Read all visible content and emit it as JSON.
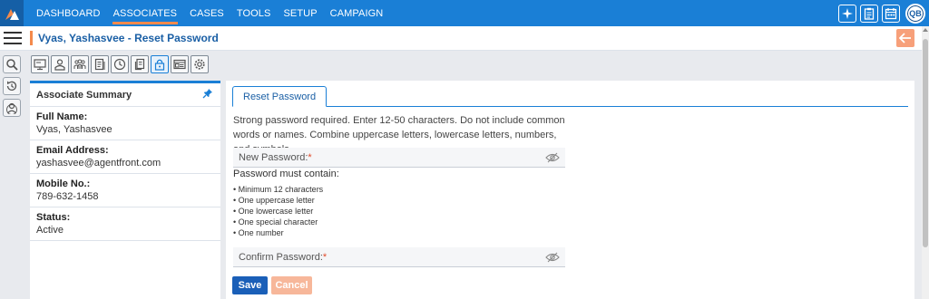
{
  "nav": {
    "items": [
      {
        "label": "DASHBOARD"
      },
      {
        "label": "ASSOCIATES"
      },
      {
        "label": "CASES"
      },
      {
        "label": "TOOLS"
      },
      {
        "label": "SETUP"
      },
      {
        "label": "CAMPAIGN"
      }
    ],
    "active": "ASSOCIATES",
    "user_initials": "QB"
  },
  "page": {
    "title": "Vyas, Yashasvee - Reset Password"
  },
  "summary": {
    "title": "Associate Summary",
    "fields": [
      {
        "label": "Full Name:",
        "value": "Vyas, Yashasvee"
      },
      {
        "label": "Email Address:",
        "value": "yashasvee@agentfront.com"
      },
      {
        "label": "Mobile No.:",
        "value": "789-632-1458"
      },
      {
        "label": "Status:",
        "value": "Active"
      }
    ]
  },
  "form": {
    "tab_label": "Reset Password",
    "description": "Strong password required. Enter 12-50 characters. Do not include common words or names. Combine uppercase letters, lowercase letters, numbers, and symbols.",
    "new_password_placeholder": "New Password:",
    "confirm_password_placeholder": "Confirm Password:",
    "required_mark": "*",
    "rules_title": "Password must contain:",
    "rules": [
      "Minimum 12 characters",
      "One uppercase letter",
      "One lowercase letter",
      "One special character",
      "One number"
    ],
    "save_label": "Save",
    "cancel_label": "Cancel"
  },
  "colors": {
    "primary": "#1a7fd6",
    "accent": "#f48a4c",
    "save": "#1a5fb8",
    "cancel": "#f7b79a"
  }
}
